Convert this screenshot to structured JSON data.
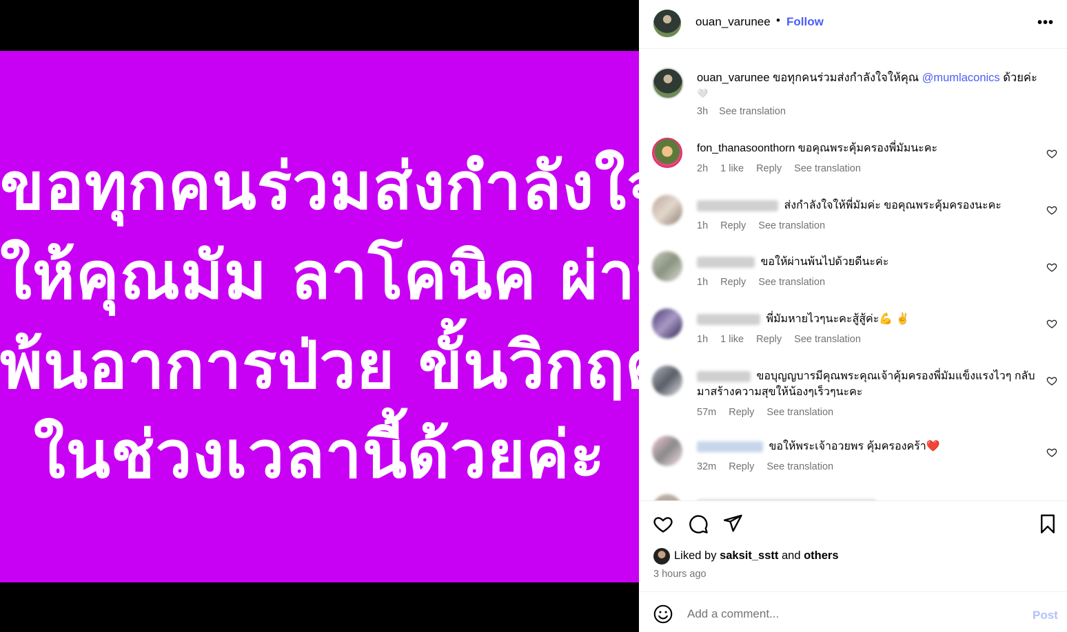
{
  "media": {
    "background_color": "#c800f4",
    "lines": [
      "ขอทุกคนร่วมส่งกำลังใจ",
      "ให้คุณมัม ลาโคนิค ผ่าน",
      "พ้นอาการป่วย ขั้นวิกฤต",
      "ในช่วงเวลานี้ด้วยค่ะ"
    ]
  },
  "header": {
    "username": "ouan_varunee",
    "separator": "•",
    "follow_label": "Follow",
    "more_icon": "more-horizontal-icon"
  },
  "caption": {
    "username": "ouan_varunee",
    "text_before": "ขอทุกคนร่วมส่งกำลังใจให้คุณ",
    "mention": "@mumlaconics",
    "text_after": "ด้วยค่ะ",
    "emoji": "🤍",
    "time": "3h",
    "see_translation": "See translation"
  },
  "comments": [
    {
      "username": "fon_thanasoonthorn",
      "username_blurred": false,
      "text": "ขอคุณพระคุ้มครองพี่มัมนะคะ",
      "time": "2h",
      "likes": "1 like",
      "reply": "Reply",
      "see_translation": "See translation"
    },
    {
      "username": "",
      "username_blurred": true,
      "text": "ส่งกำลังใจให้พี่มัมค่ะ ขอคุณพระคุ้มครองนะคะ",
      "time": "1h",
      "likes": "",
      "reply": "Reply",
      "see_translation": "See translation"
    },
    {
      "username": "",
      "username_blurred": true,
      "text": "ขอให้ผ่านพ้นไปด้วยดีนะค่ะ",
      "time": "1h",
      "likes": "",
      "reply": "Reply",
      "see_translation": "See translation"
    },
    {
      "username": "",
      "username_blurred": true,
      "text": "พี่มัมหายไวๆนะคะสู้สู้ค่ะ💪 ✌️",
      "time": "1h",
      "likes": "1 like",
      "reply": "Reply",
      "see_translation": "See translation"
    },
    {
      "username": "",
      "username_blurred": true,
      "text": "ขอบุญญบารมีคุณพระคุณเจ้าคุ้มครองพี่มัมแข็งแรงไวๆ กลับมาสร้างความสุขให้น้องๆเร็วๆนะคะ",
      "time": "57m",
      "likes": "",
      "reply": "Reply",
      "see_translation": "See translation"
    },
    {
      "username": "",
      "username_blurred": true,
      "text": "ขอให้พระเจ้าอวยพร คุ้มครองคร้า❤️",
      "time": "32m",
      "likes": "",
      "reply": "Reply",
      "see_translation": "See translation"
    }
  ],
  "actions": {
    "like_icon": "heart-icon",
    "comment_icon": "comment-icon",
    "share_icon": "send-icon",
    "save_icon": "bookmark-icon",
    "liked_by_prefix": "Liked by",
    "liked_by_user": "saksit_sstt",
    "liked_by_and": "and",
    "liked_by_others": "others",
    "timestamp": "3 hours ago"
  },
  "composer": {
    "emoji_icon": "emoji-icon",
    "placeholder": "Add a comment...",
    "post_label": "Post"
  }
}
